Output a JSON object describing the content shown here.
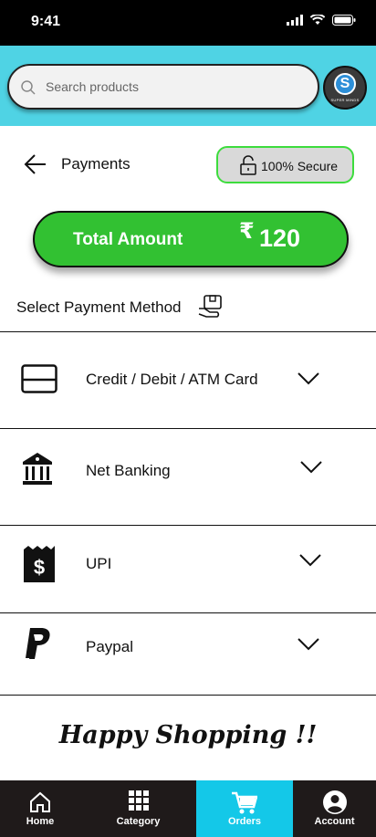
{
  "status_bar": {
    "time": "9:41"
  },
  "header": {
    "search": {
      "placeholder": "Search products"
    },
    "logo": {
      "letter": "S",
      "text": "SUPER MINDS"
    }
  },
  "page": {
    "title": "Payments",
    "secure_label": "100% Secure",
    "total": {
      "label": "Total Amount",
      "currency": "₹",
      "value": "120"
    },
    "select_label": "Select Payment Method"
  },
  "methods": [
    {
      "label": "Credit / Debit / ATM Card",
      "icon": "credit-card-icon"
    },
    {
      "label": "Net Banking",
      "icon": "bank-icon"
    },
    {
      "label": "UPI",
      "icon": "upi-receipt-icon"
    },
    {
      "label": "Paypal",
      "icon": "paypal-icon"
    }
  ],
  "footer_message": "Happy Shopping !!",
  "nav": [
    {
      "label": "Home",
      "icon": "home-icon"
    },
    {
      "label": "Category",
      "icon": "grid-icon"
    },
    {
      "label": "Orders",
      "icon": "cart-icon",
      "active": true
    },
    {
      "label": "Account",
      "icon": "account-icon"
    }
  ],
  "colors": {
    "header_bg": "#4fd3e4",
    "total_green": "#32c132",
    "secure_border": "#3ddc3d",
    "nav_active": "#14c8e8",
    "nav_bg": "#1f1a1a"
  }
}
